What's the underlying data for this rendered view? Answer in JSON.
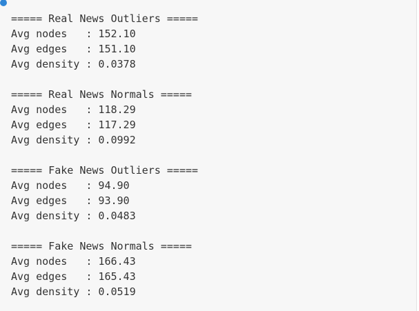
{
  "output": {
    "lines": [
      "===== Real News Outliers =====",
      "Avg nodes   : 152.10",
      "Avg edges   : 151.10",
      "Avg density : 0.0378",
      "",
      "===== Real News Normals =====",
      "Avg nodes   : 118.29",
      "Avg edges   : 117.29",
      "Avg density : 0.0992",
      "",
      "===== Fake News Outliers =====",
      "Avg nodes   : 94.90",
      "Avg edges   : 93.90",
      "Avg density : 0.0483",
      "",
      "===== Fake News Normals =====",
      "Avg nodes   : 166.43",
      "Avg edges   : 165.43",
      "Avg density : 0.0519"
    ]
  },
  "colors": {
    "background": "#f7f7f7",
    "text": "#333333",
    "indicator": "#2f86d6"
  }
}
